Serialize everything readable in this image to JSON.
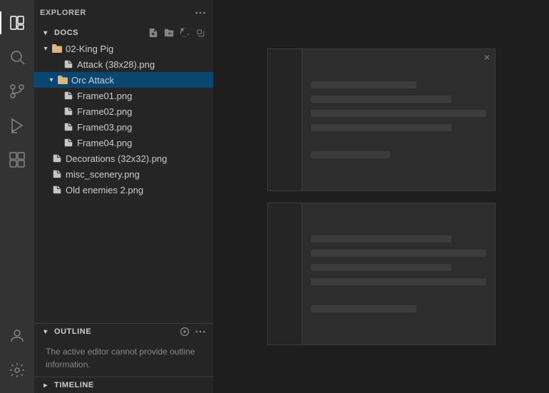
{
  "activityBar": {
    "icons": [
      {
        "name": "files-icon",
        "label": "Explorer",
        "active": true,
        "symbol": "⧉"
      },
      {
        "name": "search-icon",
        "label": "Search",
        "active": false,
        "symbol": "🔍"
      },
      {
        "name": "source-control-icon",
        "label": "Source Control",
        "active": false,
        "symbol": "⑂"
      },
      {
        "name": "run-icon",
        "label": "Run",
        "active": false,
        "symbol": "▷"
      },
      {
        "name": "extensions-icon",
        "label": "Extensions",
        "active": false,
        "symbol": "⊞"
      }
    ],
    "bottomIcons": [
      {
        "name": "account-icon",
        "label": "Account",
        "symbol": "👤"
      },
      {
        "name": "settings-icon",
        "label": "Settings",
        "symbol": "⚙"
      }
    ]
  },
  "sidebar": {
    "title": "EXPLORER",
    "moreLabel": "...",
    "docsSection": {
      "label": "DOCS",
      "actions": [
        "new-file",
        "new-folder",
        "refresh",
        "collapse"
      ]
    },
    "tree": [
      {
        "id": "king-pig",
        "type": "folder",
        "label": "02-King Pig",
        "indent": 0,
        "expanded": true
      },
      {
        "id": "attack-png",
        "type": "file",
        "label": "Attack (38x28).png",
        "indent": 1,
        "expanded": false
      },
      {
        "id": "orc-attack",
        "type": "folder",
        "label": "Orc Attack",
        "indent": 1,
        "expanded": true,
        "selected": true
      },
      {
        "id": "frame01",
        "type": "file",
        "label": "Frame01.png",
        "indent": 2
      },
      {
        "id": "frame02",
        "type": "file",
        "label": "Frame02.png",
        "indent": 2
      },
      {
        "id": "frame03",
        "type": "file",
        "label": "Frame03.png",
        "indent": 2
      },
      {
        "id": "frame04",
        "type": "file",
        "label": "Frame04.png",
        "indent": 2
      },
      {
        "id": "decorations",
        "type": "file",
        "label": "Decorations (32x32).png",
        "indent": 0
      },
      {
        "id": "misc-scenery",
        "type": "file",
        "label": "misc_scenery.png",
        "indent": 0
      },
      {
        "id": "old-enemies",
        "type": "file",
        "label": "Old enemies 2.png",
        "indent": 0
      }
    ],
    "outline": {
      "title": "OUTLINE",
      "message": "The active editor cannot provide outline information."
    },
    "timeline": {
      "title": "TIMELINE"
    }
  },
  "mainContent": {
    "closeLabel": "×"
  }
}
